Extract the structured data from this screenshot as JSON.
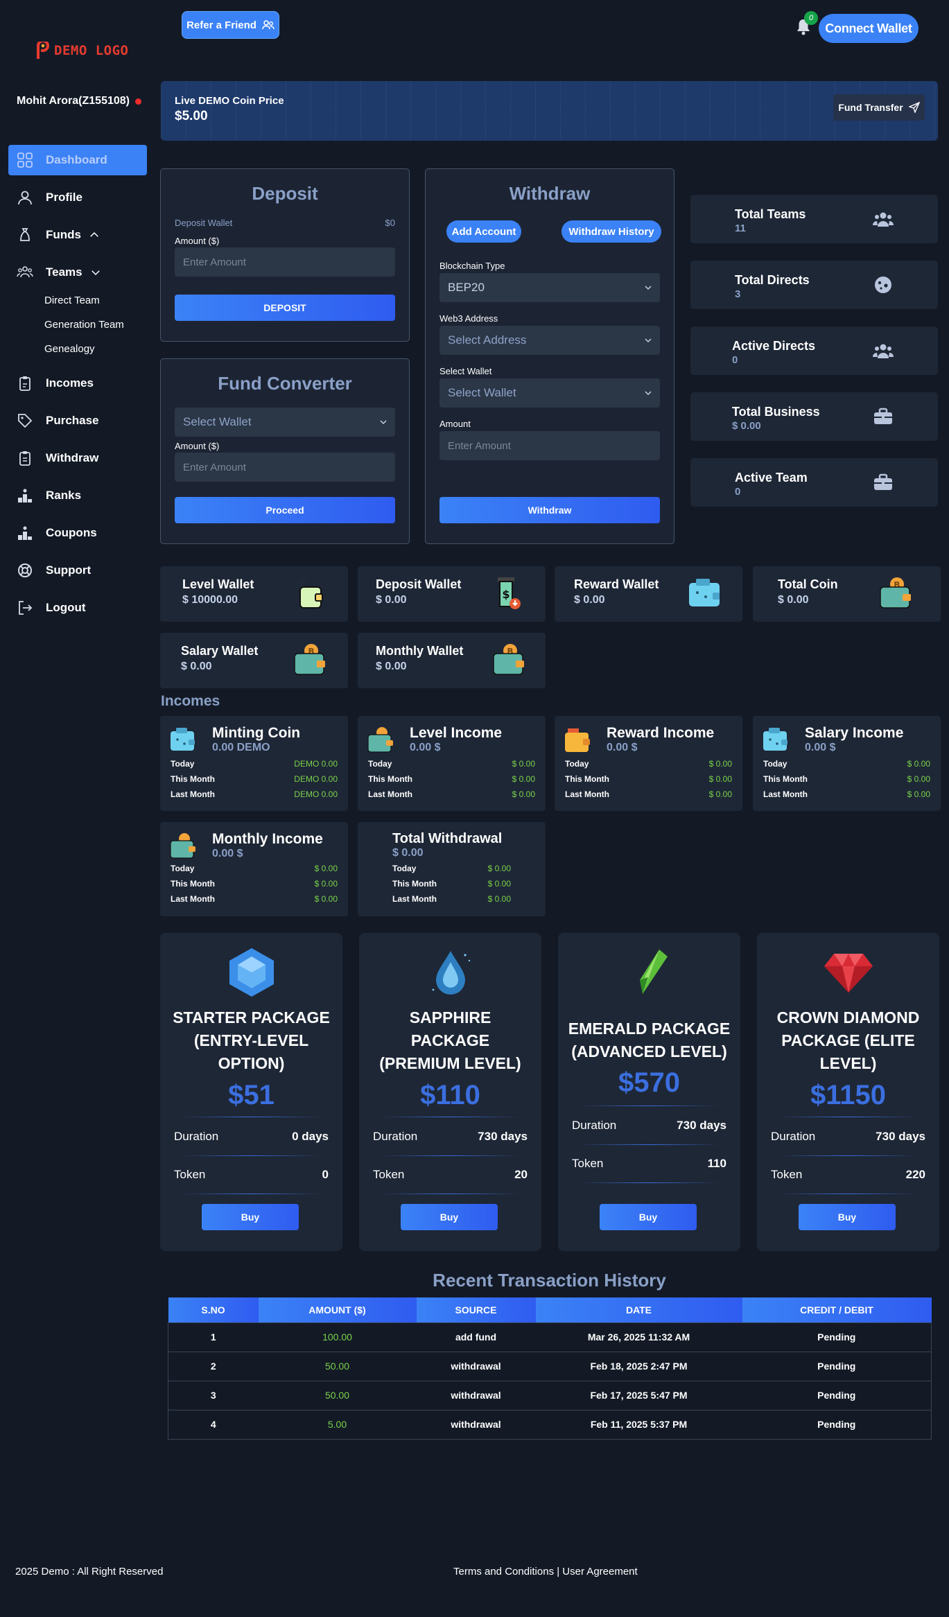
{
  "header": {
    "refer_label": "Refer a Friend",
    "notification_count": "0",
    "connect_label": "Connect Wallet"
  },
  "sidebar": {
    "logo_text": "DEMO LOGO",
    "user_name": "Mohit Arora(Z155108)",
    "items": [
      {
        "label": "Dashboard"
      },
      {
        "label": "Profile"
      },
      {
        "label": "Funds"
      },
      {
        "label": "Teams"
      },
      {
        "label": "Incomes"
      },
      {
        "label": "Purchase"
      },
      {
        "label": "Withdraw"
      },
      {
        "label": "Ranks"
      },
      {
        "label": "Coupons"
      },
      {
        "label": "Support"
      },
      {
        "label": "Logout"
      }
    ],
    "team_sub": [
      "Direct Team",
      "Generation Team",
      "Genealogy"
    ]
  },
  "banner": {
    "label": "Live DEMO Coin Price",
    "value": "$5.00",
    "fund_transfer": "Fund Transfer"
  },
  "deposit": {
    "title": "Deposit",
    "wallet_label": "Deposit Wallet",
    "wallet_value": "$0",
    "amount_label": "Amount ($)",
    "amount_placeholder": "Enter Amount",
    "button": "DEPOSIT"
  },
  "converter": {
    "title": "Fund Converter",
    "select_value": "Select Wallet",
    "amount_label": "Amount ($)",
    "amount_placeholder": "Enter Amount",
    "button": "Proceed"
  },
  "withdraw": {
    "title": "Withdraw",
    "add_account": "Add Account",
    "history": "Withdraw History",
    "chain_label": "Blockchain Type",
    "chain_value": "BEP20",
    "web3_label": "Web3 Address",
    "web3_value": "Select Address",
    "wallet_label": "Select Wallet",
    "wallet_value": "Select Wallet",
    "amount_label": "Amount",
    "amount_placeholder": "Enter Amount",
    "button": "Withdraw"
  },
  "stats": [
    {
      "title": "Total Teams",
      "value": "11"
    },
    {
      "title": "Total Directs",
      "value": "3"
    },
    {
      "title": "Active Directs",
      "value": "0"
    },
    {
      "title": "Total Business",
      "value": "$ 0.00"
    },
    {
      "title": "Active Team",
      "value": "0"
    }
  ],
  "wallets": [
    {
      "title": "Level Wallet",
      "value": "$ 10000.00"
    },
    {
      "title": "Deposit Wallet",
      "value": "$ 0.00"
    },
    {
      "title": "Reward Wallet",
      "value": "$ 0.00"
    },
    {
      "title": "Total Coin",
      "value": "$ 0.00"
    },
    {
      "title": "Salary Wallet",
      "value": "$ 0.00"
    },
    {
      "title": "Monthly Wallet",
      "value": "$ 0.00"
    }
  ],
  "incomes": {
    "heading": "Incomes",
    "row_labels": [
      "Today",
      "This Month",
      "Last Month"
    ],
    "cards": [
      {
        "title": "Minting Coin",
        "value": "0.00 DEMO",
        "rows": [
          "DEMO 0.00",
          "DEMO 0.00",
          "DEMO 0.00"
        ]
      },
      {
        "title": "Level Income",
        "value": "0.00 $",
        "rows": [
          "$ 0.00",
          "$ 0.00",
          "$ 0.00"
        ]
      },
      {
        "title": "Reward Income",
        "value": "0.00 $",
        "rows": [
          "$ 0.00",
          "$ 0.00",
          "$ 0.00"
        ]
      },
      {
        "title": "Salary Income",
        "value": "0.00 $",
        "rows": [
          "$ 0.00",
          "$ 0.00",
          "$ 0.00"
        ]
      },
      {
        "title": "Monthly Income",
        "value": "0.00 $",
        "rows": [
          "$ 0.00",
          "$ 0.00",
          "$ 0.00"
        ]
      },
      {
        "title": "Total Withdrawal",
        "value": "$ 0.00",
        "rows": [
          "$ 0.00",
          "$ 0.00",
          "$ 0.00"
        ]
      }
    ]
  },
  "packages": {
    "duration_label": "Duration",
    "token_label": "Token",
    "buy_label": "Buy",
    "items": [
      {
        "name_lines": [
          "STARTER PACKAGE",
          "(ENTRY-LEVEL",
          "OPTION)"
        ],
        "price": "$51",
        "duration": "0 days",
        "token": "0",
        "gem": "hexagon-gem-icon"
      },
      {
        "name_lines": [
          "SAPPHIRE",
          "PACKAGE",
          "(PREMIUM LEVEL)"
        ],
        "price": "$110",
        "duration": "730 days",
        "token": "20",
        "gem": "water-drop-gem-icon"
      },
      {
        "name_lines": [
          "EMERALD PACKAGE",
          "(ADVANCED LEVEL)"
        ],
        "price": "$570",
        "duration": "730 days",
        "token": "110",
        "gem": "emerald-crystal-icon"
      },
      {
        "name_lines": [
          "CROWN DIAMOND",
          "PACKAGE (ELITE",
          "LEVEL)"
        ],
        "price": "$1150",
        "duration": "730 days",
        "token": "220",
        "gem": "red-diamond-icon"
      }
    ]
  },
  "transactions": {
    "title": "Recent Transaction History",
    "columns": [
      "S.NO",
      "AMOUNT ($)",
      "SOURCE",
      "DATE",
      "CREDIT / DEBIT"
    ],
    "rows": [
      [
        "1",
        "100.00",
        "add fund",
        "Mar 26, 2025 11:32 AM",
        "Pending"
      ],
      [
        "2",
        "50.00",
        "withdrawal",
        "Feb 18, 2025 2:47 PM",
        "Pending"
      ],
      [
        "3",
        "50.00",
        "withdrawal",
        "Feb 17, 2025 5:47 PM",
        "Pending"
      ],
      [
        "4",
        "5.00",
        "withdrawal",
        "Feb 11, 2025 5:37 PM",
        "Pending"
      ]
    ]
  },
  "footer": {
    "copyright": "2025 Demo : All Right Reserved",
    "links": "Terms and Conditions | User Agreement"
  },
  "colors": {
    "background": "#131a26",
    "accent": "#3b82f6",
    "card": "#1e2736",
    "positive": "#7bd24a",
    "muted_blue": "#8aa0c7"
  }
}
